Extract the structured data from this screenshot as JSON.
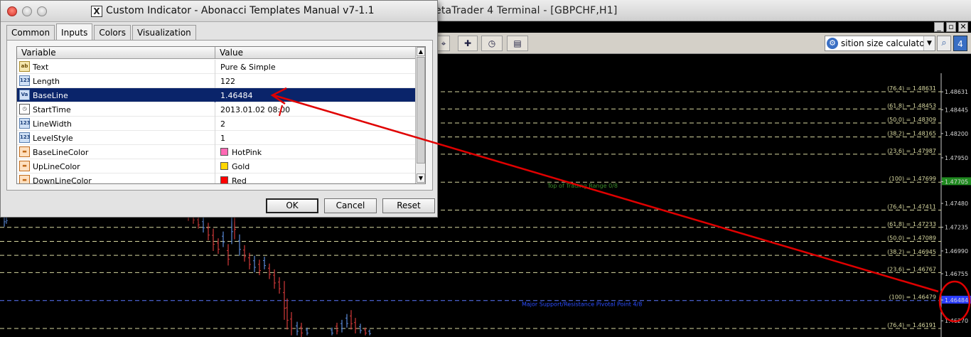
{
  "terminal": {
    "title": "MetaTrader 4 Terminal - [GBPCHF,H1]",
    "title_visible": "etaTrader 4 Terminal - [GBPCHF,H1]",
    "mdi_minimize": "_",
    "mdi_restore": "▫",
    "mdi_close": "✕"
  },
  "toolbar": {
    "search_value": "sition size calculator",
    "search_badge": "4"
  },
  "dialog": {
    "title": "Custom Indicator - Abonacci Templates Manual v7-1.1",
    "tabs": [
      "Common",
      "Inputs",
      "Colors",
      "Visualization"
    ],
    "active_tab": "Inputs",
    "grid": {
      "col_variable": "Variable",
      "col_value": "Value",
      "rows": [
        {
          "icon": "ab",
          "name": "Text",
          "value": "Pure & Simple"
        },
        {
          "icon": "123",
          "name": "Length",
          "value": "122"
        },
        {
          "icon": "Va",
          "name": "BaseLine",
          "value": "1.46484"
        },
        {
          "icon": "clock",
          "name": "StartTime",
          "value": "2013.01.02 08:00"
        },
        {
          "icon": "123",
          "name": "LineWidth",
          "value": "2"
        },
        {
          "icon": "123",
          "name": "LevelStyle",
          "value": "1"
        },
        {
          "icon": "color",
          "name": "BaseLineColor",
          "value": "HotPink",
          "color": "#FF69B4"
        },
        {
          "icon": "color",
          "name": "UpLineColor",
          "value": "Gold",
          "color": "#FFD700"
        },
        {
          "icon": "color",
          "name": "DownLineColor",
          "value": "Red",
          "color": "#FF0000"
        }
      ],
      "selected_row": "BaseLine"
    },
    "buttons": {
      "ok": "OK",
      "cancel": "Cancel",
      "reset": "Reset"
    }
  },
  "chart": {
    "symbol": "GBPCHF,H1",
    "background": "#000000",
    "fib_line_color": "#D8D8A0",
    "axis_labels": [
      "1.48631",
      "1.48445",
      "1.48200",
      "1.47950",
      "1.47705",
      "1.47480",
      "1.47235",
      "1.46990",
      "1.46755",
      "1.46484",
      "1.46270"
    ],
    "axis_prices": [
      1.4863,
      1.48445,
      1.482,
      1.4795,
      1.47705,
      1.4748,
      1.47235,
      1.4699,
      1.46755,
      1.46484,
      1.4627
    ],
    "current_price": "1.46484",
    "levels": [
      {
        "label": "(76.4) = 1.48631",
        "price": 1.48631
      },
      {
        "label": "(61.8) = 1.48453",
        "price": 1.48453
      },
      {
        "label": "(50.0) = 1.48309",
        "price": 1.48309
      },
      {
        "label": "(38.2) = 1.48165",
        "price": 1.48165
      },
      {
        "label": "(23.6) = 1.47987",
        "price": 1.47987
      },
      {
        "label": "(100) = 1.47699",
        "price": 1.47699
      },
      {
        "label": "(76.4) = 1.47411",
        "price": 1.47411
      },
      {
        "label": "(61.8) = 1.47233",
        "price": 1.47233
      },
      {
        "label": "(50.0) = 1.47089",
        "price": 1.47089
      },
      {
        "label": "(38.2) = 1.46945",
        "price": 1.46945
      },
      {
        "label": "(23.6) = 1.46767",
        "price": 1.46767
      },
      {
        "label": "(100) = 1.46479",
        "price": 1.46479
      },
      {
        "label": "(76.4) = 1.46191",
        "price": 1.46191
      }
    ],
    "top_range_label": "Top of Trading Range  0/8",
    "top_range_color": "#3A8A2A",
    "pivot_label": "Major Support/Resistance Pivotal Point 4/8",
    "pivot_color": "#2A4CFF",
    "top_range_highlight": "1.47705",
    "pivot_highlight": "1.46484"
  },
  "annotation": {
    "color": "#E00000"
  }
}
